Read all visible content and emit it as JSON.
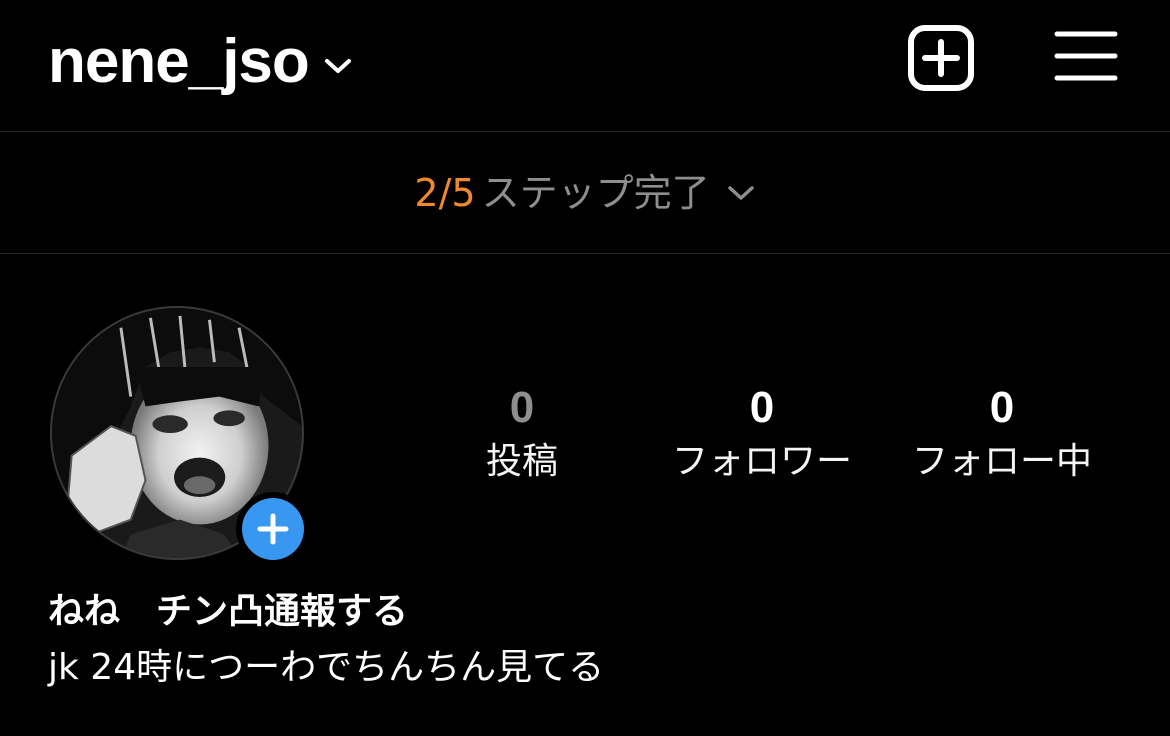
{
  "header": {
    "username": "nene_jso",
    "icons": {
      "account_switcher": "chevron-down-icon",
      "create": "plus-square-icon",
      "menu": "hamburger-menu-icon"
    }
  },
  "setup_progress": {
    "count": "2/5",
    "label": "ステップ完了",
    "icon": "chevron-down-icon",
    "completed": 2,
    "total": 5
  },
  "profile": {
    "avatar": "profile-avatar-image",
    "add_story_icon": "plus-icon",
    "stats": [
      {
        "value": "0",
        "label": "投稿"
      },
      {
        "value": "0",
        "label": "フォロワー"
      },
      {
        "value": "0",
        "label": "フォロー中"
      }
    ],
    "display_name": "ねね　チン凸通報する",
    "bio": "jk 24時につーわでちんちん見てる"
  },
  "colors": {
    "background": "#000000",
    "text": "#ffffff",
    "muted": "#8e8e8e",
    "progress_accent": "#f0892c",
    "add_story_blue": "#3897f0",
    "divider": "#262626"
  }
}
